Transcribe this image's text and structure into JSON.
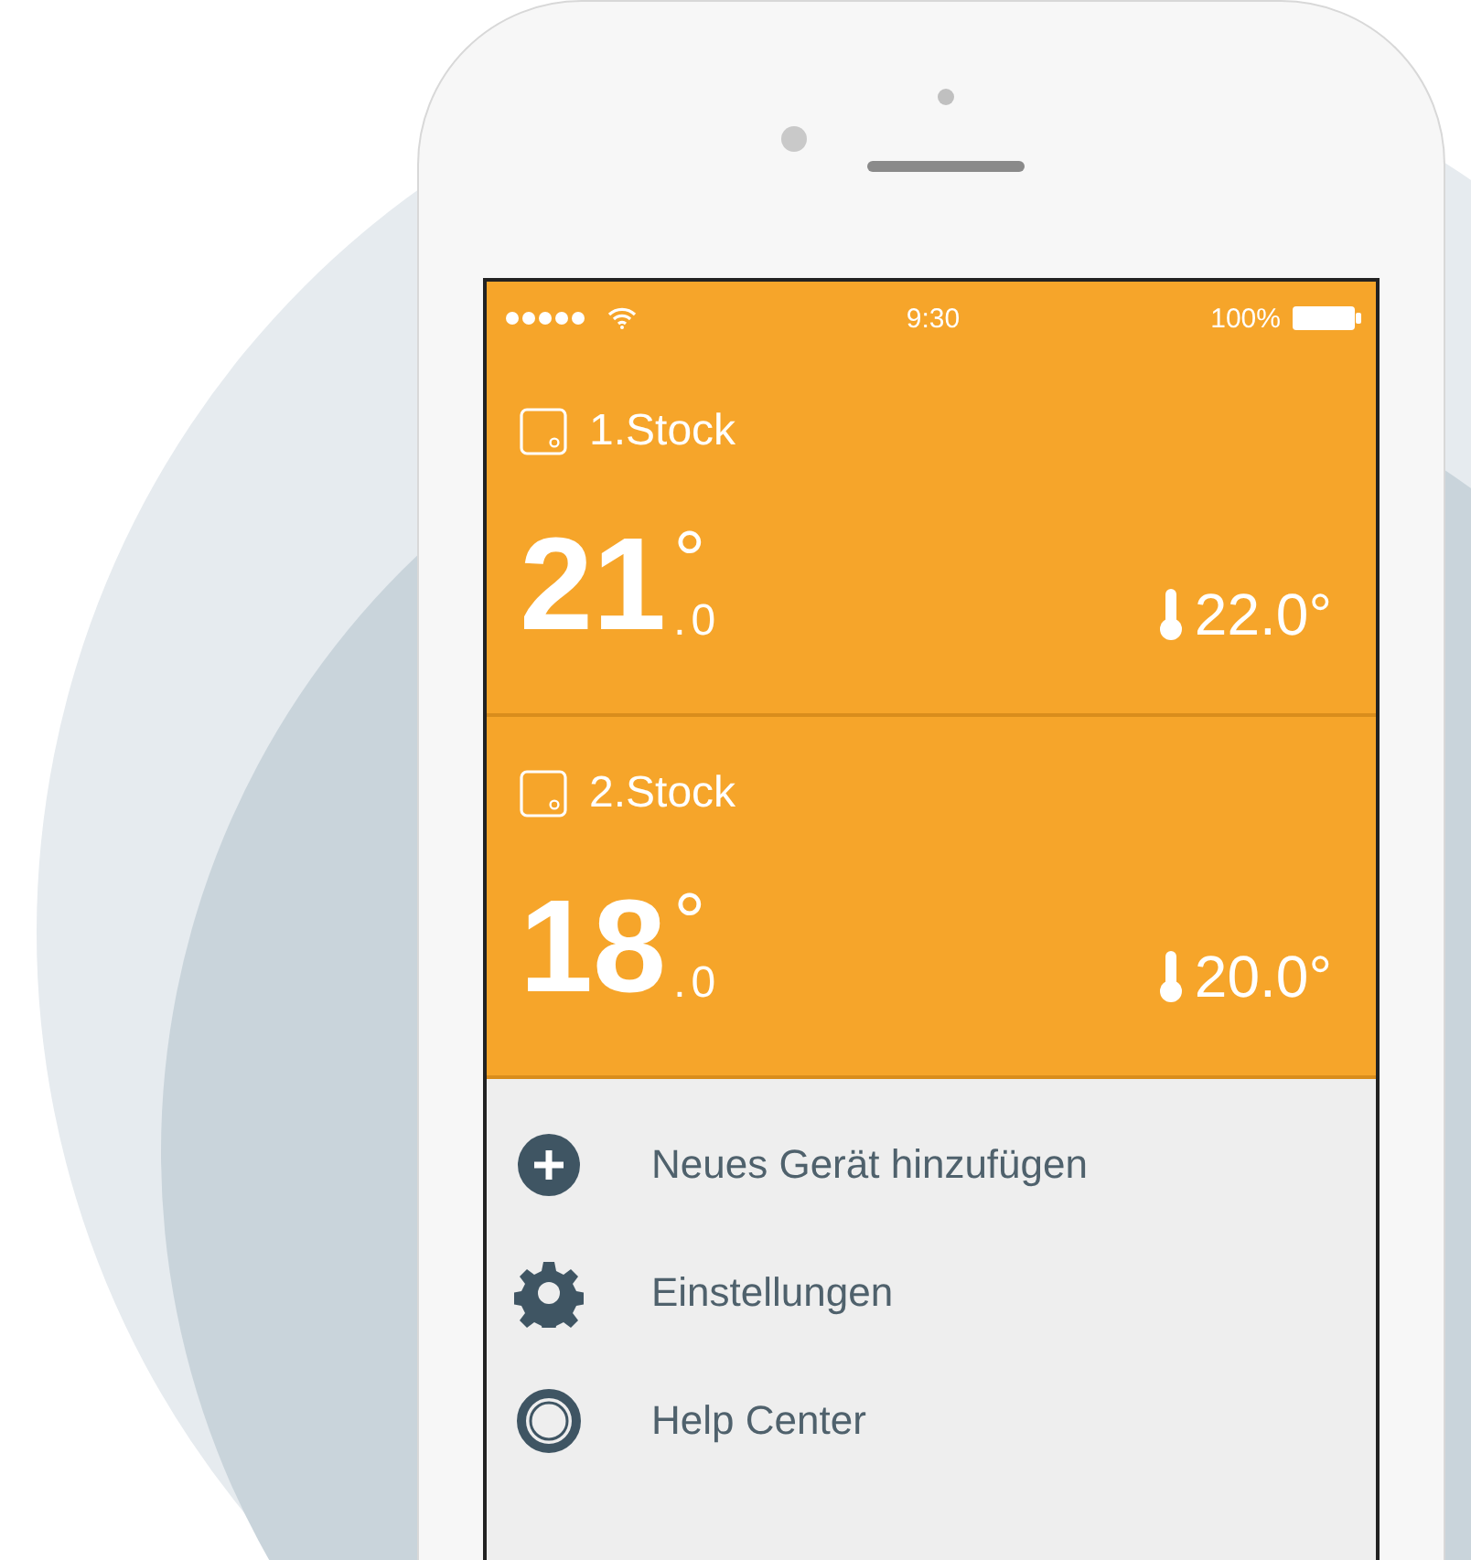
{
  "status_bar": {
    "time": "9:30",
    "battery": "100%"
  },
  "rooms": [
    {
      "name": "1.Stock",
      "temperature": "21",
      "unit": "°",
      "decimal": ".0",
      "target": "22.0°"
    },
    {
      "name": "2.Stock",
      "temperature": "18",
      "unit": "°",
      "decimal": ".0",
      "target": "20.0°"
    }
  ],
  "menu": [
    {
      "kind": "add",
      "label": "Neues Gerät hinzufügen"
    },
    {
      "kind": "settings",
      "label": "Einstellungen"
    },
    {
      "kind": "help",
      "label": "Help Center"
    }
  ]
}
